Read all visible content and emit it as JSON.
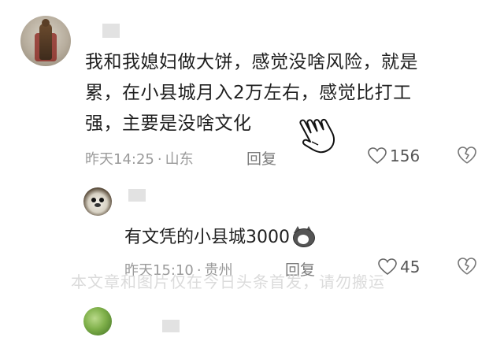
{
  "comment": {
    "text_lines": [
      "我和我媳妇做大饼，感觉没啥风险，就是",
      "累，在小县城月入2万左右，感觉比打工",
      "强，主要是没啥文化"
    ],
    "time": "昨天14:25",
    "dot": "·",
    "location": "山东",
    "reply_label": "回复",
    "like_count": "156"
  },
  "reply": {
    "text": "有文凭的小县城3000",
    "time": "昨天15:10",
    "dot": "·",
    "location": "贵州",
    "reply_label": "回复",
    "like_count": "45"
  },
  "watermark": "本文章和图片仅在今日头条首发，请勿搬运",
  "icons": {
    "like": "heart-outline-icon",
    "dislike": "broken-heart-icon",
    "cursor": "hand-pointer-icon",
    "emoji": "husky-emoji-icon"
  },
  "colors": {
    "text": "#1f1f1f",
    "meta": "#9a9a9a",
    "icon": "#555555"
  }
}
